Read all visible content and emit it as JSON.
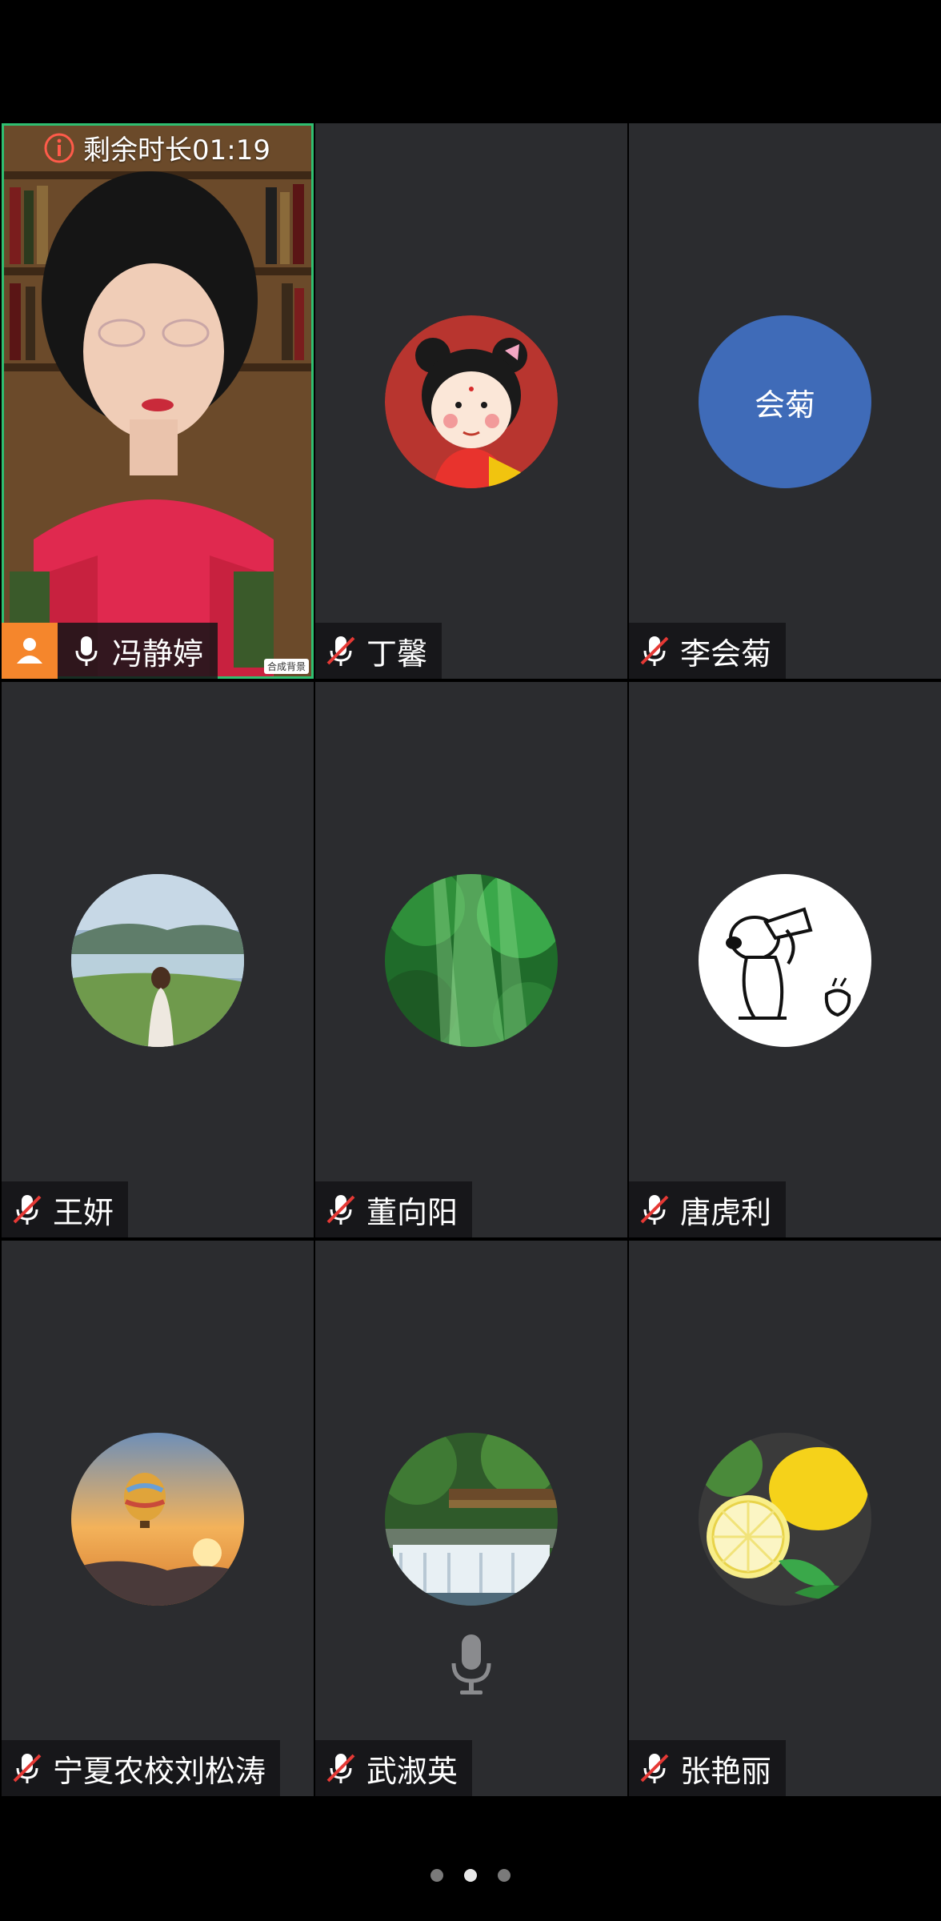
{
  "meeting": {
    "timer_label": "剩余时长01:19",
    "badge_text": "合成背景"
  },
  "participants": [
    {
      "name": "冯静婷",
      "avatar": "video-feed",
      "muted": false,
      "host": true
    },
    {
      "name": "丁馨",
      "avatar": "cartoon-girl-avatar",
      "muted": true
    },
    {
      "name": "李会菊",
      "avatar_text": "会菊",
      "avatar": "text-avatar",
      "muted": true
    },
    {
      "name": "王妍",
      "avatar": "lake-landscape-avatar",
      "muted": true
    },
    {
      "name": "董向阳",
      "avatar": "green-forest-avatar",
      "muted": true
    },
    {
      "name": "唐虎利",
      "avatar": "snoopy-avatar",
      "muted": true
    },
    {
      "name": "宁夏农校刘松涛",
      "avatar": "hot-air-balloon-avatar",
      "muted": true
    },
    {
      "name": "武淑英",
      "avatar": "waterfall-avatar",
      "muted": true
    },
    {
      "name": "张艳丽",
      "avatar": "lemon-avatar",
      "muted": true
    }
  ],
  "pagination": {
    "pages": 3,
    "current": 2
  },
  "colors": {
    "host_badge": "#f5862c",
    "text_avatar_bg": "#3f6bb8",
    "active_border": "#2fbf71",
    "tile_bg": "#2b2c2f"
  }
}
